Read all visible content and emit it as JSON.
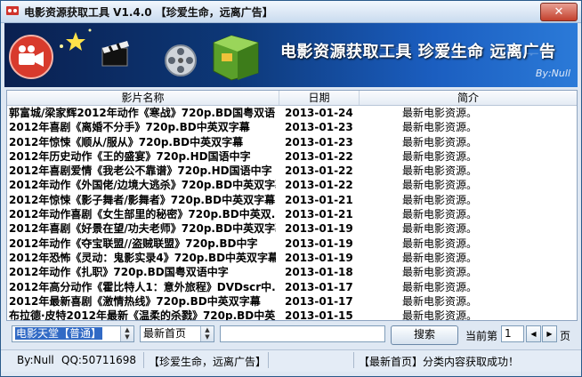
{
  "window": {
    "title": "电影资源获取工具 V1.4.0 【珍爱生命，远离广告】",
    "close_icon": "close-icon"
  },
  "banner": {
    "headline": "电影资源获取工具  珍爱生命 远离广告",
    "author": "By:Null"
  },
  "table": {
    "columns": [
      "影片名称",
      "日期",
      "简介"
    ],
    "rows": [
      {
        "title": "郭富城/梁家辉2012年动作《寒战》720p.BD国粤双语...",
        "date": "2013-01-24",
        "note": "最新电影资源。"
      },
      {
        "title": "2012年喜剧《离婚不分手》720p.BD中英双字幕",
        "date": "2013-01-23",
        "note": "最新电影资源。"
      },
      {
        "title": "2012年惊悚《顺从/服从》720p.BD中英双字幕",
        "date": "2013-01-23",
        "note": "最新电影资源。"
      },
      {
        "title": "2012年历史动作《王的盛宴》720p.HD国语中字",
        "date": "2013-01-22",
        "note": "最新电影资源。"
      },
      {
        "title": "2012年喜剧爱情《我老公不靠谱》720p.HD国语中字",
        "date": "2013-01-22",
        "note": "最新电影资源。"
      },
      {
        "title": "2012年动作《外国佬/边境大逃杀》720p.BD中英双字幕",
        "date": "2013-01-22",
        "note": "最新电影资源。"
      },
      {
        "title": "2012年惊悚《影子舞者/影舞者》720p.BD中英双字幕",
        "date": "2013-01-21",
        "note": "最新电影资源。"
      },
      {
        "title": "2012年动作喜剧《女生部里的秘密》720p.BD中英双...",
        "date": "2013-01-21",
        "note": "最新电影资源。"
      },
      {
        "title": "2012年喜剧《好景在望/功夫老师》720p.BD中英双字幕",
        "date": "2013-01-19",
        "note": "最新电影资源。"
      },
      {
        "title": "2012年动作《夺宝联盟//盗贼联盟》720p.BD中字",
        "date": "2013-01-19",
        "note": "最新电影资源。"
      },
      {
        "title": "2012年恐怖《灵动：鬼影实录4》720p.BD中英双字幕",
        "date": "2013-01-19",
        "note": "最新电影资源。"
      },
      {
        "title": "2012年动作《扎职》720p.BD国粤双语中字",
        "date": "2013-01-18",
        "note": "最新电影资源。"
      },
      {
        "title": "2012年高分动作《霍比特人1：意外旅程》DVDscr中...",
        "date": "2013-01-17",
        "note": "最新电影资源。"
      },
      {
        "title": "2012年最新喜剧《激情热线》720p.BD中英双字幕",
        "date": "2013-01-17",
        "note": "最新电影资源。"
      },
      {
        "title": "布拉德·皮特2012年最新《温柔的杀戮》720p.BD中英...",
        "date": "2013-01-15",
        "note": "最新电影资源。"
      }
    ]
  },
  "controls": {
    "source_selected": "电影天堂【普通】",
    "category_selected": "最新首页",
    "search_value": "",
    "search_button": "搜索",
    "page_label": "当前第",
    "page_value": "1",
    "page_unit": "页",
    "prev_icon": "chevron-left-icon",
    "next_icon": "chevron-right-icon"
  },
  "status": {
    "author": "By:Null",
    "qq": "QQ:50711698",
    "slogan": "【珍爱生命，远离广告】",
    "message": "【最新首页】分类内容获取成功！"
  },
  "colors": {
    "banner_dark": "#0a2050",
    "banner_light": "#2b7ad8",
    "selection": "#316ac5",
    "close_red": "#c3412d"
  }
}
